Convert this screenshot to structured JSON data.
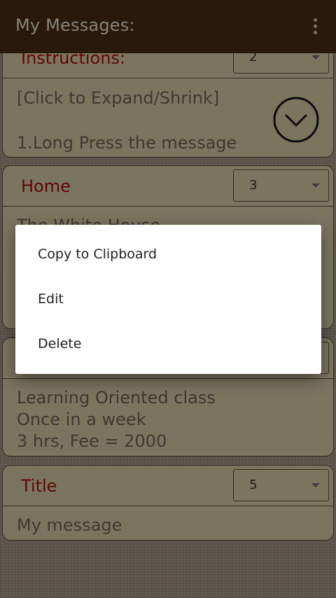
{
  "app_bar": {
    "title": "My Messages:",
    "overflow_icon": "more-vertical-icon"
  },
  "cards": [
    {
      "title": "Instructions:",
      "spinner_value": "2",
      "body": [
        "[Click to Expand/Shrink]",
        "",
        "1.Long Press the message"
      ],
      "expand_icon": "chevron-down-circle-icon"
    },
    {
      "title": "Home",
      "spinner_value": "3",
      "body": [
        "The White House"
      ]
    },
    {
      "title": "",
      "spinner_value": "",
      "body": [
        "Learning Oriented class",
        "Once in a week",
        "3 hrs, Fee = 2000"
      ]
    },
    {
      "title": "Title",
      "spinner_value": "5",
      "body": [
        "My message"
      ]
    }
  ],
  "context_menu": {
    "items": [
      "Copy to Clipboard",
      "Edit",
      "Delete"
    ]
  },
  "colors": {
    "app_bar": "#3b2511",
    "card_background": "#b6ad8e",
    "card_title": "#8a0c05",
    "scrim": "rgba(0,0,0,0.32)"
  }
}
